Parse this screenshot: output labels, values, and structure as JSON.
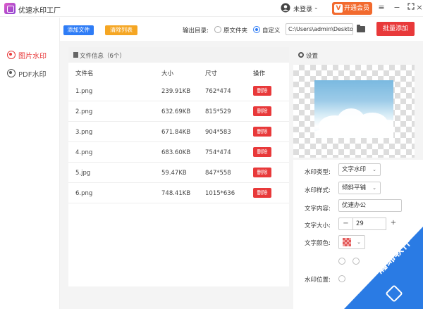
{
  "app": {
    "title": "优速水印工厂"
  },
  "titlebar": {
    "login": "未登录",
    "vip": "开通会员",
    "vip_icon": "V"
  },
  "sidebar": {
    "items": [
      {
        "label": "图片水印",
        "active": true
      },
      {
        "label": "PDF水印",
        "active": false
      }
    ]
  },
  "toolbar": {
    "add_files": "添加文件",
    "clear_list": "清除列表",
    "output_label": "输出目录:",
    "radio_original": "原文件夹",
    "radio_custom": "自定义",
    "path_value": "C:\\Users\\admin\\Deskto",
    "batch_add": "批量添加"
  },
  "files": {
    "header": "文件信息（6个）",
    "columns": [
      "文件名",
      "大小",
      "尺寸",
      "操作"
    ],
    "delete_label": "删除",
    "rows": [
      {
        "name": "1.png",
        "size": "239.91KB",
        "dim": "762*474"
      },
      {
        "name": "2.png",
        "size": "632.69KB",
        "dim": "815*529"
      },
      {
        "name": "3.png",
        "size": "671.84KB",
        "dim": "904*583"
      },
      {
        "name": "4.png",
        "size": "683.60KB",
        "dim": "754*474"
      },
      {
        "name": "5.jpg",
        "size": "59.47KB",
        "dim": "847*558"
      },
      {
        "name": "6.png",
        "size": "748.41KB",
        "dim": "1015*636"
      }
    ]
  },
  "settings": {
    "title": "设置",
    "type_label": "水印类型:",
    "type_value": "文字水印",
    "style_label": "水印样式:",
    "style_value": "倾斜平铺",
    "content_label": "文字内容:",
    "content_value": "优速办公",
    "size_label": "文字大小:",
    "size_value": "29",
    "minus": "−",
    "plus": "+",
    "color_label": "文字颜色:",
    "position_label": "水印位置:"
  },
  "watermark": {
    "text": "瀚绵软件"
  },
  "colors": {
    "accent_red": "#e8393a",
    "accent_blue": "#2e7cf6",
    "orange": "#f5a623",
    "vip_orange": "#f26a2e"
  }
}
